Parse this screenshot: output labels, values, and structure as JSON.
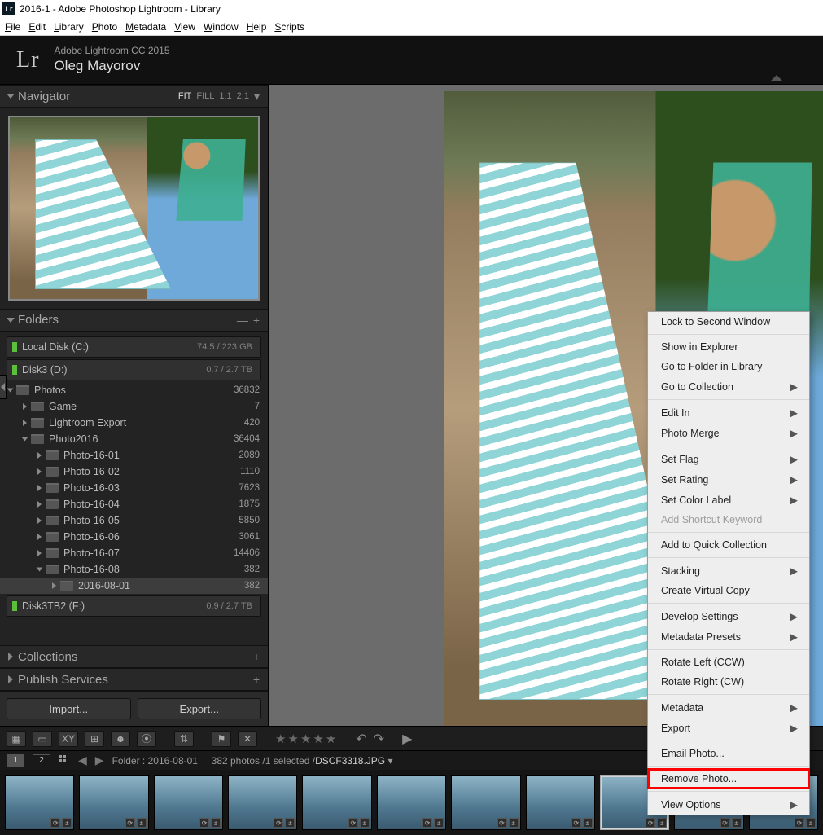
{
  "titlebar": {
    "text": "2016-1 - Adobe Photoshop Lightroom - Library",
    "icon_label": "Lr"
  },
  "menubar": {
    "items": [
      "File",
      "Edit",
      "Library",
      "Photo",
      "Metadata",
      "View",
      "Window",
      "Help",
      "Scripts"
    ]
  },
  "identity": {
    "product": "Adobe Lightroom CC 2015",
    "user": "Oleg Mayorov",
    "logo": "Lr"
  },
  "navigator": {
    "title": "Navigator",
    "zoom_levels": [
      "FIT",
      "FILL",
      "1:1",
      "2:1"
    ],
    "zoom_selected": 0
  },
  "folders": {
    "title": "Folders",
    "volumes": [
      {
        "name": "Local Disk (C:)",
        "size": "74.5 / 223 GB"
      },
      {
        "name": "Disk3 (D:)",
        "size": "0.7 / 2.7 TB"
      }
    ],
    "tree": [
      {
        "depth": 0,
        "open": true,
        "name": "Photos",
        "count": "36832"
      },
      {
        "depth": 1,
        "open": false,
        "name": "Game",
        "count": "7"
      },
      {
        "depth": 1,
        "open": false,
        "name": "Lightroom Export",
        "count": "420"
      },
      {
        "depth": 1,
        "open": true,
        "name": "Photo2016",
        "count": "36404"
      },
      {
        "depth": 2,
        "open": false,
        "name": "Photo-16-01",
        "count": "2089"
      },
      {
        "depth": 2,
        "open": false,
        "name": "Photo-16-02",
        "count": "1110"
      },
      {
        "depth": 2,
        "open": false,
        "name": "Photo-16-03",
        "count": "7623"
      },
      {
        "depth": 2,
        "open": false,
        "name": "Photo-16-04",
        "count": "1875"
      },
      {
        "depth": 2,
        "open": false,
        "name": "Photo-16-05",
        "count": "5850"
      },
      {
        "depth": 2,
        "open": false,
        "name": "Photo-16-06",
        "count": "3061"
      },
      {
        "depth": 2,
        "open": false,
        "name": "Photo-16-07",
        "count": "14406"
      },
      {
        "depth": 2,
        "open": true,
        "name": "Photo-16-08",
        "count": "382"
      },
      {
        "depth": 3,
        "open": false,
        "name": "2016-08-01",
        "count": "382",
        "selected": true
      }
    ],
    "volume_after": {
      "name": "Disk3TB2 (F:)",
      "size": "0.9 / 2.7 TB"
    }
  },
  "collections_panel": {
    "title": "Collections"
  },
  "publish_panel": {
    "title": "Publish Services"
  },
  "buttons": {
    "import": "Import...",
    "export": "Export..."
  },
  "filmstrip_header": {
    "monitors": [
      "1",
      "2"
    ],
    "monitor_selected": 0,
    "folder_label": "Folder :",
    "folder": "2016-08-01",
    "count_text": "382 photos",
    "sel_text": "1 selected",
    "filename": "DSCF3318.JPG"
  },
  "context_menu": {
    "groups": [
      [
        {
          "label": "Lock to Second Window"
        }
      ],
      [
        {
          "label": "Show in Explorer"
        },
        {
          "label": "Go to Folder in Library"
        },
        {
          "label": "Go to Collection",
          "sub": true
        }
      ],
      [
        {
          "label": "Edit In",
          "sub": true
        },
        {
          "label": "Photo Merge",
          "sub": true
        }
      ],
      [
        {
          "label": "Set Flag",
          "sub": true
        },
        {
          "label": "Set Rating",
          "sub": true
        },
        {
          "label": "Set Color Label",
          "sub": true
        },
        {
          "label": "Add Shortcut Keyword",
          "disabled": true
        }
      ],
      [
        {
          "label": "Add to Quick Collection"
        }
      ],
      [
        {
          "label": "Stacking",
          "sub": true
        },
        {
          "label": "Create Virtual Copy"
        }
      ],
      [
        {
          "label": "Develop Settings",
          "sub": true
        },
        {
          "label": "Metadata Presets",
          "sub": true
        }
      ],
      [
        {
          "label": "Rotate Left (CCW)"
        },
        {
          "label": "Rotate Right (CW)"
        }
      ],
      [
        {
          "label": "Metadata",
          "sub": true
        },
        {
          "label": "Export",
          "sub": true
        }
      ],
      [
        {
          "label": "Email Photo..."
        }
      ],
      [
        {
          "label": "Remove Photo...",
          "highlight": true
        }
      ],
      [
        {
          "label": "View Options",
          "sub": true
        }
      ]
    ]
  },
  "filmstrip": {
    "thumb_count": 11,
    "selected_index": 8
  }
}
